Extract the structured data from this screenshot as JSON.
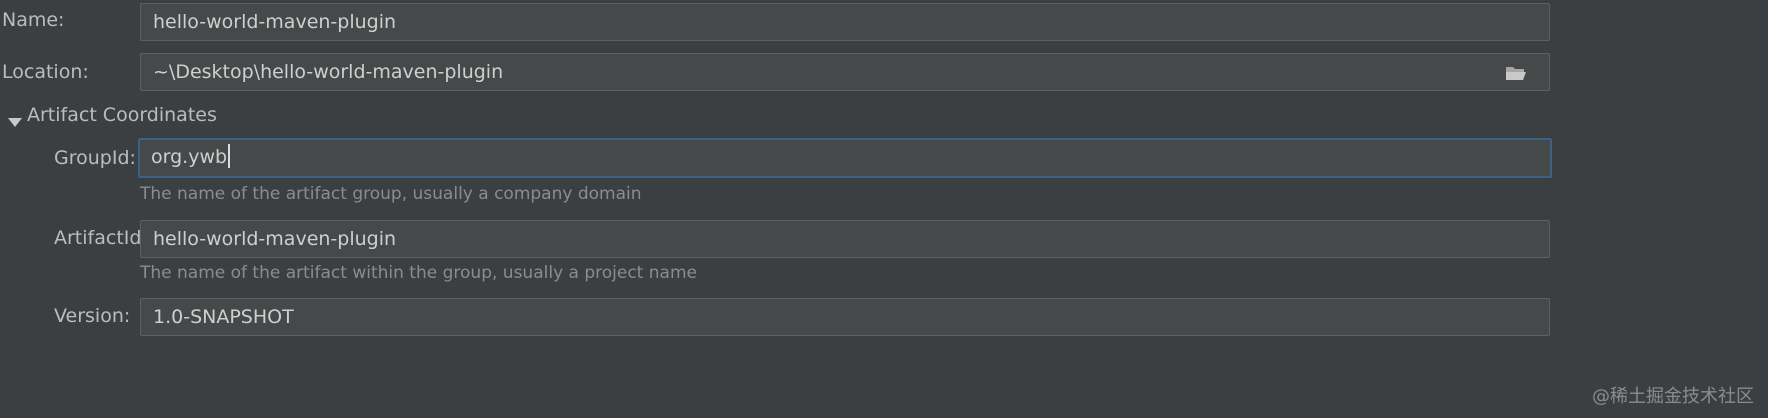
{
  "form": {
    "name": {
      "label": "Name:",
      "value": "hello-world-maven-plugin"
    },
    "location": {
      "label": "Location:",
      "value": "~\\Desktop\\hello-world-maven-plugin",
      "browse_icon": "folder-open-icon"
    },
    "artifact_section": {
      "label": "Artifact Coordinates",
      "expanded": true,
      "group_id": {
        "label": "GroupId:",
        "value": "org.ywb",
        "hint": "The name of the artifact group, usually a company domain"
      },
      "artifact_id": {
        "label": "ArtifactId:",
        "value": "hello-world-maven-plugin",
        "hint": "The name of the artifact within the group, usually a project name"
      },
      "version": {
        "label": "Version:",
        "value": "1.0-SNAPSHOT"
      }
    }
  },
  "watermark": "@稀土掘金技术社区",
  "colors": {
    "background": "#3c3f41",
    "field_background": "#45494a",
    "focus_border": "#3d6185"
  }
}
